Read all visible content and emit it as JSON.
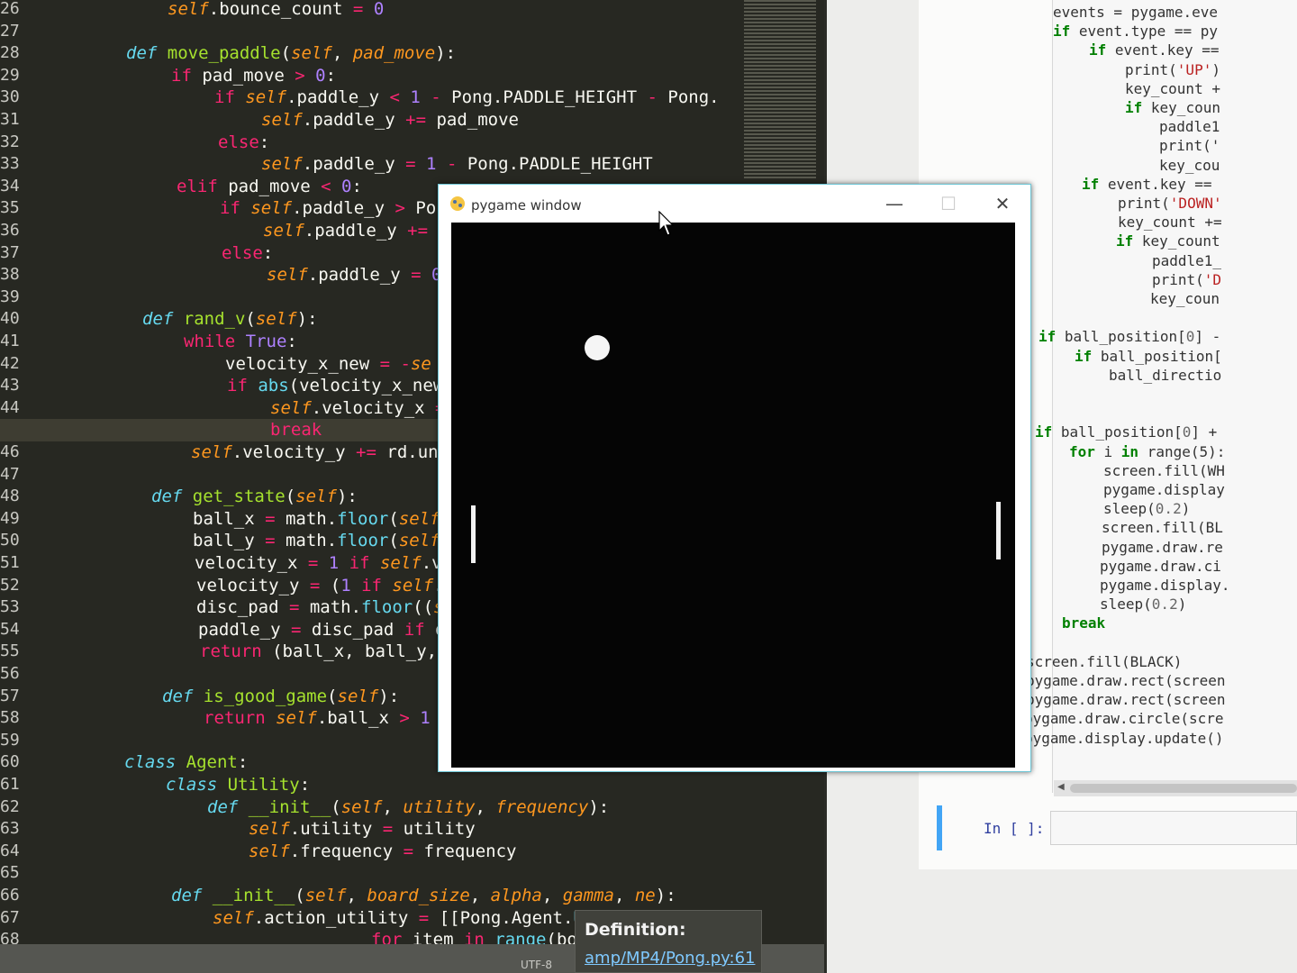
{
  "editor": {
    "highlight_line": "45",
    "lines": [
      {
        "n": "26",
        "segs": [
          [
            "sf",
            "self"
          ],
          [
            "",
            ".bounce_count "
          ],
          [
            "kw",
            "="
          ],
          [
            "nm",
            " 0"
          ]
        ]
      },
      {
        "n": "27",
        "segs": []
      },
      {
        "n": "28",
        "segs": [
          [
            "df",
            "def "
          ],
          [
            "fn",
            "move_paddle"
          ],
          [
            "",
            "("
          ],
          [
            "sf",
            "self"
          ],
          [
            "",
            ", "
          ],
          [
            "sf",
            "pad_move"
          ],
          [
            "",
            "):"
          ]
        ]
      },
      {
        "n": "29",
        "segs": [
          [
            "kw",
            "if "
          ],
          [
            "",
            "pad_move "
          ],
          [
            "kw",
            ">"
          ],
          [
            "nm",
            " 0"
          ],
          [
            "",
            ":"
          ]
        ]
      },
      {
        "n": "30",
        "segs": [
          [
            "kw",
            "if "
          ],
          [
            "sf",
            "self"
          ],
          [
            "",
            ".paddle_y "
          ],
          [
            "kw",
            "<"
          ],
          [
            "nm",
            " 1 "
          ],
          [
            "kw",
            "-"
          ],
          [
            "",
            " Pong.PADDLE_HEIGHT "
          ],
          [
            "kw",
            "-"
          ],
          [
            "",
            " Pong."
          ]
        ]
      },
      {
        "n": "31",
        "segs": [
          [
            "sf",
            "self"
          ],
          [
            "",
            ".paddle_y "
          ],
          [
            "kw",
            "+="
          ],
          [
            "",
            " pad_move"
          ]
        ]
      },
      {
        "n": "32",
        "segs": [
          [
            "kw",
            "else"
          ],
          [
            "",
            ":"
          ]
        ]
      },
      {
        "n": "33",
        "segs": [
          [
            "sf",
            "self"
          ],
          [
            "",
            ".paddle_y "
          ],
          [
            "kw",
            "="
          ],
          [
            "nm",
            " 1 "
          ],
          [
            "kw",
            "-"
          ],
          [
            "",
            " Pong.PADDLE_HEIGHT"
          ]
        ]
      },
      {
        "n": "34",
        "segs": [
          [
            "kw",
            "elif "
          ],
          [
            "",
            "pad_move "
          ],
          [
            "kw",
            "<"
          ],
          [
            "nm",
            " 0"
          ],
          [
            "",
            ":"
          ]
        ]
      },
      {
        "n": "35",
        "segs": [
          [
            "kw",
            "if "
          ],
          [
            "sf",
            "self"
          ],
          [
            "",
            ".paddle_y "
          ],
          [
            "kw",
            ">"
          ],
          [
            "",
            " Po"
          ]
        ]
      },
      {
        "n": "36",
        "segs": [
          [
            "sf",
            "self"
          ],
          [
            "",
            ".paddle_y "
          ],
          [
            "kw",
            "+="
          ]
        ]
      },
      {
        "n": "37",
        "segs": [
          [
            "kw",
            "else"
          ],
          [
            "",
            ":"
          ]
        ]
      },
      {
        "n": "38",
        "segs": [
          [
            "sf",
            "self"
          ],
          [
            "",
            ".paddle_y "
          ],
          [
            "kw",
            "="
          ],
          [
            "nm",
            " 0"
          ]
        ]
      },
      {
        "n": "39",
        "segs": []
      },
      {
        "n": "40",
        "segs": [
          [
            "df",
            "def "
          ],
          [
            "fn",
            "rand_v"
          ],
          [
            "",
            "("
          ],
          [
            "sf",
            "self"
          ],
          [
            "",
            "):"
          ]
        ]
      },
      {
        "n": "41",
        "segs": [
          [
            "kw",
            "while "
          ],
          [
            "nm",
            "True"
          ],
          [
            "",
            ":"
          ]
        ]
      },
      {
        "n": "42",
        "segs": [
          [
            "",
            "velocity_x_new "
          ],
          [
            "kw",
            "="
          ],
          [
            "kw",
            " -"
          ],
          [
            "sf",
            "se"
          ]
        ]
      },
      {
        "n": "43",
        "segs": [
          [
            "kw",
            "if "
          ],
          [
            "bi",
            "abs"
          ],
          [
            "",
            "(velocity_x_new"
          ]
        ]
      },
      {
        "n": "44",
        "segs": [
          [
            "sf",
            "self"
          ],
          [
            "",
            ".velocity_x "
          ],
          [
            "kw",
            "="
          ]
        ]
      },
      {
        "n": "45",
        "segs": [
          [
            "kw",
            "break"
          ]
        ]
      },
      {
        "n": "46",
        "segs": [
          [
            "sf",
            "self"
          ],
          [
            "",
            ".velocity_y "
          ],
          [
            "kw",
            "+="
          ],
          [
            "",
            " rd.un"
          ]
        ]
      },
      {
        "n": "47",
        "segs": []
      },
      {
        "n": "48",
        "segs": [
          [
            "df",
            "def "
          ],
          [
            "fn",
            "get_state"
          ],
          [
            "",
            "("
          ],
          [
            "sf",
            "self"
          ],
          [
            "",
            "):"
          ]
        ]
      },
      {
        "n": "49",
        "segs": [
          [
            "",
            "ball_x "
          ],
          [
            "kw",
            "="
          ],
          [
            "",
            " math."
          ],
          [
            "bi",
            "floor"
          ],
          [
            "",
            "("
          ],
          [
            "sf",
            "self"
          ]
        ]
      },
      {
        "n": "50",
        "segs": [
          [
            "",
            "ball_y "
          ],
          [
            "kw",
            "="
          ],
          [
            "",
            " math."
          ],
          [
            "bi",
            "floor"
          ],
          [
            "",
            "("
          ],
          [
            "sf",
            "self"
          ]
        ]
      },
      {
        "n": "51",
        "segs": [
          [
            "",
            "velocity_x "
          ],
          [
            "kw",
            "="
          ],
          [
            "nm",
            " 1 "
          ],
          [
            "kw",
            "if "
          ],
          [
            "sf",
            "self"
          ],
          [
            "",
            ".ve"
          ]
        ]
      },
      {
        "n": "52",
        "segs": [
          [
            "",
            "velocity_y "
          ],
          [
            "kw",
            "="
          ],
          [
            "",
            " ("
          ],
          [
            "nm",
            "1 "
          ],
          [
            "kw",
            "if "
          ],
          [
            "sf",
            "self"
          ],
          [
            "",
            ".v"
          ]
        ]
      },
      {
        "n": "53",
        "segs": [
          [
            "",
            "disc_pad "
          ],
          [
            "kw",
            "="
          ],
          [
            "",
            " math."
          ],
          [
            "bi",
            "floor"
          ],
          [
            "",
            "(("
          ],
          [
            "sf",
            "se"
          ]
        ]
      },
      {
        "n": "54",
        "segs": [
          [
            "",
            "paddle_y "
          ],
          [
            "kw",
            "="
          ],
          [
            "",
            " disc_pad "
          ],
          [
            "kw",
            "if"
          ],
          [
            "",
            " d"
          ]
        ]
      },
      {
        "n": "55",
        "segs": [
          [
            "kw",
            "return "
          ],
          [
            "",
            "(ball_x, ball_y, v"
          ]
        ]
      },
      {
        "n": "56",
        "segs": []
      },
      {
        "n": "57",
        "segs": [
          [
            "df",
            "def "
          ],
          [
            "fn",
            "is_good_game"
          ],
          [
            "",
            "("
          ],
          [
            "sf",
            "self"
          ],
          [
            "",
            "):"
          ]
        ]
      },
      {
        "n": "58",
        "segs": [
          [
            "kw",
            "return "
          ],
          [
            "sf",
            "self"
          ],
          [
            "",
            ".ball_x "
          ],
          [
            "kw",
            ">"
          ],
          [
            "nm",
            " 1"
          ]
        ]
      },
      {
        "n": "59",
        "segs": []
      },
      {
        "n": "60",
        "segs": [
          [
            "df",
            "class "
          ],
          [
            "fn",
            "Agent"
          ],
          [
            "",
            ":"
          ]
        ]
      },
      {
        "n": "61",
        "segs": [
          [
            "df",
            "class "
          ],
          [
            "fn",
            "Utility"
          ],
          [
            "",
            ":"
          ]
        ]
      },
      {
        "n": "62",
        "segs": [
          [
            "df",
            "def "
          ],
          [
            "fn",
            "__init__"
          ],
          [
            "",
            "("
          ],
          [
            "sf",
            "self"
          ],
          [
            "",
            ", "
          ],
          [
            "sf",
            "utility"
          ],
          [
            "",
            ", "
          ],
          [
            "sf",
            "frequency"
          ],
          [
            "",
            "):"
          ]
        ]
      },
      {
        "n": "63",
        "segs": [
          [
            "sf",
            "self"
          ],
          [
            "",
            ".utility "
          ],
          [
            "kw",
            "="
          ],
          [
            "",
            " utility"
          ]
        ]
      },
      {
        "n": "64",
        "segs": [
          [
            "sf",
            "self"
          ],
          [
            "",
            ".frequency "
          ],
          [
            "kw",
            "="
          ],
          [
            "",
            " frequency"
          ]
        ]
      },
      {
        "n": "65",
        "segs": []
      },
      {
        "n": "66",
        "segs": [
          [
            "df",
            "def "
          ],
          [
            "fn",
            "__init__"
          ],
          [
            "",
            "("
          ],
          [
            "sf",
            "self"
          ],
          [
            "",
            ", "
          ],
          [
            "sf",
            "board_size"
          ],
          [
            "",
            ", "
          ],
          [
            "sf",
            "alpha"
          ],
          [
            "",
            ", "
          ],
          [
            "sf",
            "gamma"
          ],
          [
            "",
            ", "
          ],
          [
            "sf",
            "ne"
          ],
          [
            "",
            "):"
          ]
        ]
      },
      {
        "n": "67",
        "segs": [
          [
            "sf",
            "self"
          ],
          [
            "",
            ".action_utility "
          ],
          [
            "kw",
            "="
          ],
          [
            "",
            " [[Pong.Agent."
          ],
          [
            "bi",
            "Utility"
          ],
          [
            "",
            "("
          ],
          [
            "nm",
            "0"
          ],
          [
            "",
            ", "
          ],
          [
            "nm",
            "0"
          ],
          [
            "",
            ") "
          ],
          [
            "kw",
            "for"
          ]
        ]
      },
      {
        "n": "68",
        "segs": [
          [
            "kw",
            "for "
          ],
          [
            "",
            "item "
          ],
          [
            "kw",
            "in "
          ],
          [
            "bi",
            "range"
          ],
          [
            "",
            "(boa"
          ]
        ]
      }
    ],
    "encoding": "UTF-8"
  },
  "definition_popup": {
    "title": "Definition:",
    "link": "amp/MP4/Pong.py:61"
  },
  "pygame_window": {
    "title": "pygame window",
    "minimize": "—",
    "maximize": "☐",
    "close": "✕"
  },
  "notebook": {
    "lines": [
      [
        [
          "",
          "events = pygame.eve"
        ]
      ],
      [
        [
          "jk",
          "if "
        ],
        [
          "",
          "event.type == py"
        ]
      ],
      [
        [
          "jk",
          "if "
        ],
        [
          "",
          "event.key =="
        ]
      ],
      [
        [
          "",
          "print("
        ],
        [
          "js",
          "'UP'"
        ],
        [
          "",
          ")"
        ]
      ],
      [
        [
          "",
          "key_count +"
        ]
      ],
      [
        [
          "jk",
          "if "
        ],
        [
          "",
          "key_coun"
        ]
      ],
      [
        [
          "",
          "paddle1"
        ]
      ],
      [
        [
          "",
          "print('"
        ]
      ],
      [
        [
          "",
          "key_cou"
        ]
      ],
      [
        [
          "jk",
          "if "
        ],
        [
          "",
          "event.key =="
        ]
      ],
      [
        [
          "",
          "print("
        ],
        [
          "js",
          "'DOWN'"
        ]
      ],
      [
        [
          "",
          "key_count +="
        ]
      ],
      [
        [
          "jk",
          "if "
        ],
        [
          "",
          "key_count"
        ]
      ],
      [
        [
          "",
          "paddle1_"
        ]
      ],
      [
        [
          "",
          "print("
        ],
        [
          "js",
          "'D"
        ]
      ],
      [
        [
          "",
          "key_coun"
        ]
      ],
      [
        [
          "",
          ""
        ]
      ],
      [
        [
          "jk",
          "if "
        ],
        [
          "",
          "ball_position["
        ],
        [
          "jn",
          "0"
        ],
        [
          "",
          "] -"
        ]
      ],
      [
        [
          "jk",
          "if "
        ],
        [
          "",
          "ball_position["
        ]
      ],
      [
        [
          "",
          "ball_directio"
        ]
      ],
      [
        [
          "",
          ""
        ]
      ],
      [
        [
          "",
          ""
        ]
      ],
      [
        [
          "jk",
          "if "
        ],
        [
          "",
          "ball_position["
        ],
        [
          "jn",
          "0"
        ],
        [
          "",
          "] +"
        ]
      ],
      [
        [
          "jk",
          "for "
        ],
        [
          "",
          "i "
        ],
        [
          "jk",
          "in "
        ],
        [
          "",
          "range(5):"
        ]
      ],
      [
        [
          "",
          "screen.fill(WH"
        ]
      ],
      [
        [
          "",
          "pygame.display"
        ]
      ],
      [
        [
          "",
          "sleep("
        ],
        [
          "jn",
          "0.2"
        ],
        [
          "",
          ")"
        ]
      ],
      [
        [
          "",
          "screen.fill(BL"
        ]
      ],
      [
        [
          "",
          "pygame.draw.re"
        ]
      ],
      [
        [
          "",
          "pygame.draw.ci"
        ]
      ],
      [
        [
          "",
          "pygame.display."
        ]
      ],
      [
        [
          "",
          "sleep("
        ],
        [
          "jn",
          "0.2"
        ],
        [
          "",
          ")"
        ]
      ],
      [
        [
          "jk",
          "break"
        ]
      ],
      [
        [
          "",
          ""
        ]
      ],
      [
        [
          "",
          "screen.fill(BLACK)"
        ]
      ],
      [
        [
          "",
          "pygame.draw.rect(screen"
        ]
      ],
      [
        [
          "",
          "pygame.draw.rect(screen"
        ]
      ],
      [
        [
          "",
          "pygame.draw.circle(scre"
        ]
      ],
      [
        [
          "",
          "pygame.display.update()"
        ]
      ]
    ],
    "in_prompt": "In [ ]:"
  },
  "colors": {
    "editor_bg": "#272822",
    "keyword": "#f92672",
    "function": "#a6e22e",
    "self": "#fd971f",
    "number": "#ae81ff",
    "builtin": "#66d9ef"
  }
}
